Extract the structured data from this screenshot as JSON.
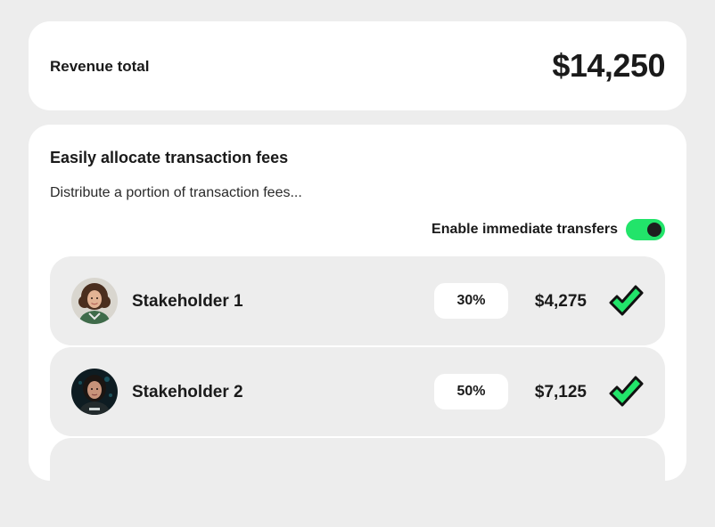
{
  "revenue": {
    "label": "Revenue total",
    "value": "$14,250"
  },
  "allocation": {
    "title": "Easily allocate transaction fees",
    "description": "Distribute a portion of transaction fees...",
    "toggle": {
      "label": "Enable immediate transfers",
      "enabled": true,
      "color": "#22e46a"
    },
    "stakeholders": [
      {
        "name": "Stakeholder 1",
        "percent": "30%",
        "amount": "$4,275",
        "checked": true,
        "avatar": "avatar-woman-curly-hair"
      },
      {
        "name": "Stakeholder 2",
        "percent": "50%",
        "amount": "$7,125",
        "checked": true,
        "avatar": "avatar-woman-dark-hair"
      }
    ]
  },
  "colors": {
    "background": "#ededed",
    "card": "#ffffff",
    "row": "#ededed",
    "accent": "#22e46a",
    "check_fill": "#22e46a",
    "check_stroke": "#111111"
  }
}
